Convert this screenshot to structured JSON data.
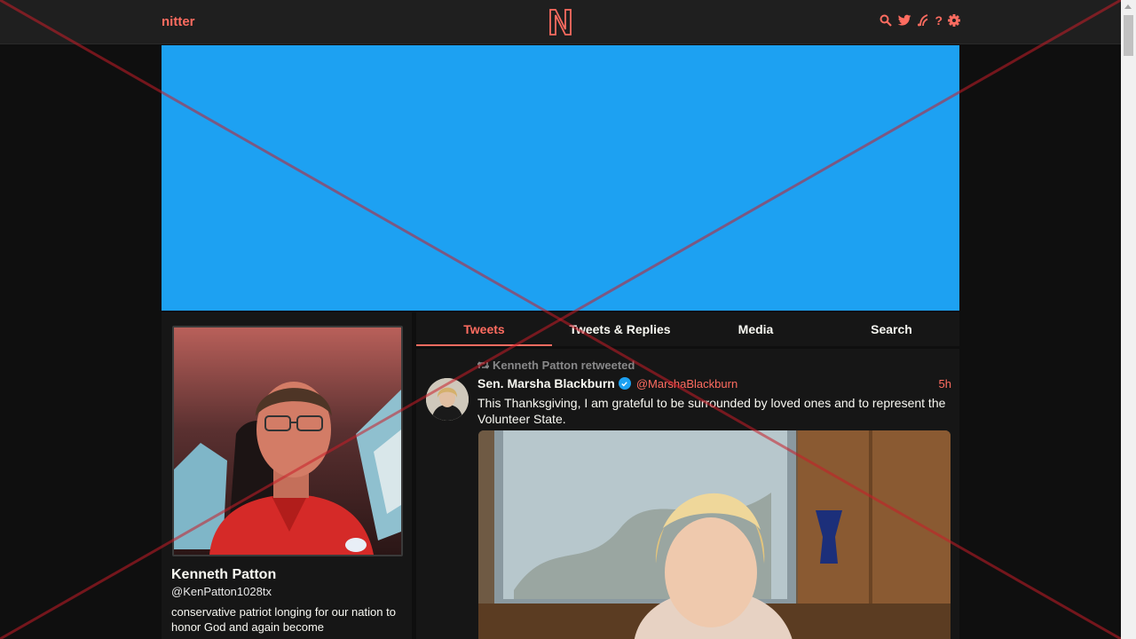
{
  "navbar": {
    "brand": "nitter",
    "icons": [
      "search-icon",
      "twitter-bird-icon",
      "rss-icon",
      "help-icon",
      "settings-gear-icon"
    ],
    "help_glyph": "?"
  },
  "colors": {
    "accent": "#ff6c60",
    "banner": "#1da1f2",
    "background": "#0f0f0f",
    "panel": "#161616",
    "navbar": "#1f1f1f"
  },
  "profile": {
    "fullname": "Kenneth Patton",
    "username": "@KenPatton1028tx",
    "bio": "conservative patriot  longing for our nation to honor God and again become"
  },
  "tabs": [
    {
      "label": "Tweets",
      "active": true
    },
    {
      "label": "Tweets & Replies",
      "active": false
    },
    {
      "label": "Media",
      "active": false
    },
    {
      "label": "Search",
      "active": false
    }
  ],
  "tweet": {
    "retweet_header": "Kenneth Patton retweeted",
    "fullname": "Sen. Marsha Blackburn",
    "username": "@MarshaBlackburn",
    "date": "5h",
    "text": "This Thanksgiving, I am grateful to be surrounded by loved ones and to represent the Volunteer State."
  }
}
